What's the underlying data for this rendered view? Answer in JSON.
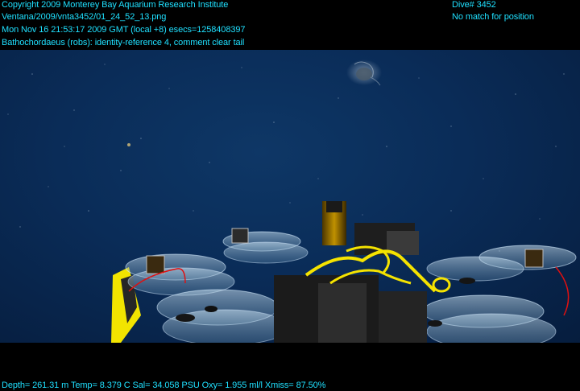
{
  "overlay": {
    "copyright": "Copyright 2009 Monterey Bay Aquarium Research Institute",
    "filename": "Ventana/2009/vnta3452/01_24_52_13.png",
    "datetime": "Mon Nov 16 21:53:17 2009 GMT (local +8)  esecs=1258408397",
    "annotation": "Bathochordaeus (robs): identity-reference 4, comment clear tail",
    "dive": "Dive# 3452",
    "position_status": "No match for position",
    "telemetry": "Depth= 261.31 m  Temp= 8.379 C  Sal= 34.058 PSU  Oxy= 1.955 ml/l  Xmiss= 87.50%"
  },
  "colors": {
    "text": "#1fe0ff",
    "water": "#0a2c58",
    "frame": "#f2e400"
  }
}
